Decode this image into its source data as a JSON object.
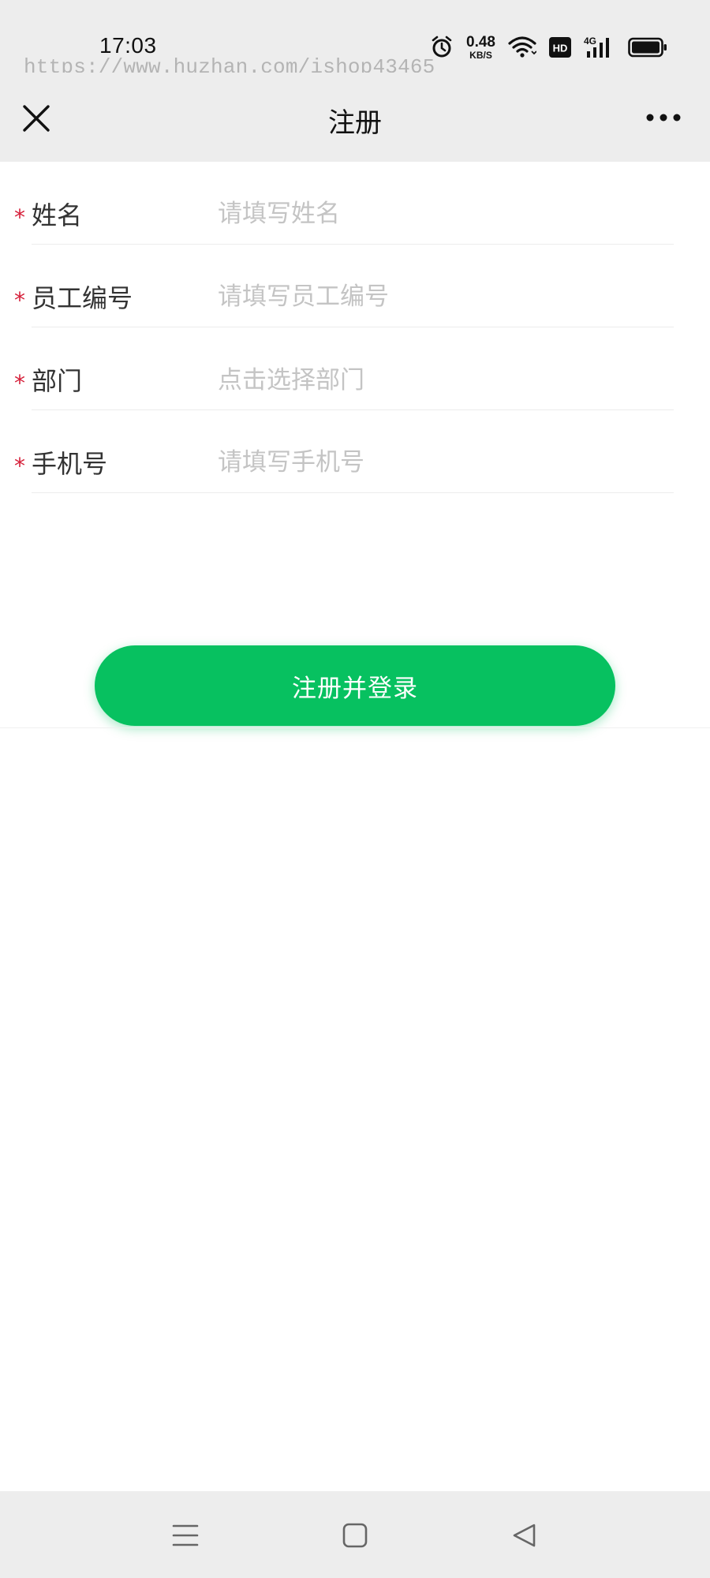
{
  "status_bar": {
    "time": "17:03",
    "watermark": "https://www.huzhan.com/ishop43465",
    "net_speed_value": "0.48",
    "net_speed_unit": "KB/S",
    "hd_badge": "HD",
    "network_type": "4G",
    "icons": [
      "alarm-icon",
      "wifi-icon",
      "hd-icon",
      "signal-icon",
      "battery-icon"
    ]
  },
  "nav": {
    "title": "注册",
    "close_icon": "close-icon",
    "more_icon": "more-icon"
  },
  "form": {
    "required_mark": "*",
    "fields": [
      {
        "label": "姓名",
        "placeholder": "请填写姓名",
        "value": ""
      },
      {
        "label": "员工编号",
        "placeholder": "请填写员工编号",
        "value": ""
      },
      {
        "label": "部门",
        "placeholder": "点击选择部门",
        "value": ""
      },
      {
        "label": "手机号",
        "placeholder": "请填写手机号",
        "value": ""
      }
    ],
    "submit_label": "注册并登录"
  },
  "colors": {
    "accent": "#07c160",
    "required": "#d6203a",
    "bar_background": "#ededed",
    "placeholder": "#c4c4c4"
  },
  "system_nav": {
    "icons": [
      "menu-icon",
      "home-icon",
      "back-icon"
    ]
  }
}
